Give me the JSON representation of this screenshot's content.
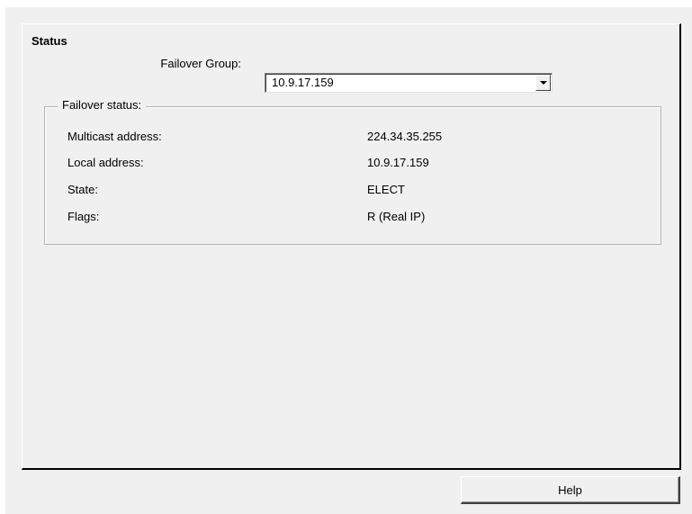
{
  "panel": {
    "title": "Status"
  },
  "failover_group": {
    "label": "Failover Group:",
    "selected_value": "10.9.17.159"
  },
  "failover_status": {
    "legend": "Failover status:",
    "rows": [
      {
        "label": "Multicast address:",
        "value": "224.34.35.255"
      },
      {
        "label": "Local address:",
        "value": "10.9.17.159"
      },
      {
        "label": "State:",
        "value": "ELECT"
      },
      {
        "label": "Flags:",
        "value": "R (Real IP)"
      }
    ]
  },
  "footer": {
    "help_label": "Help"
  }
}
